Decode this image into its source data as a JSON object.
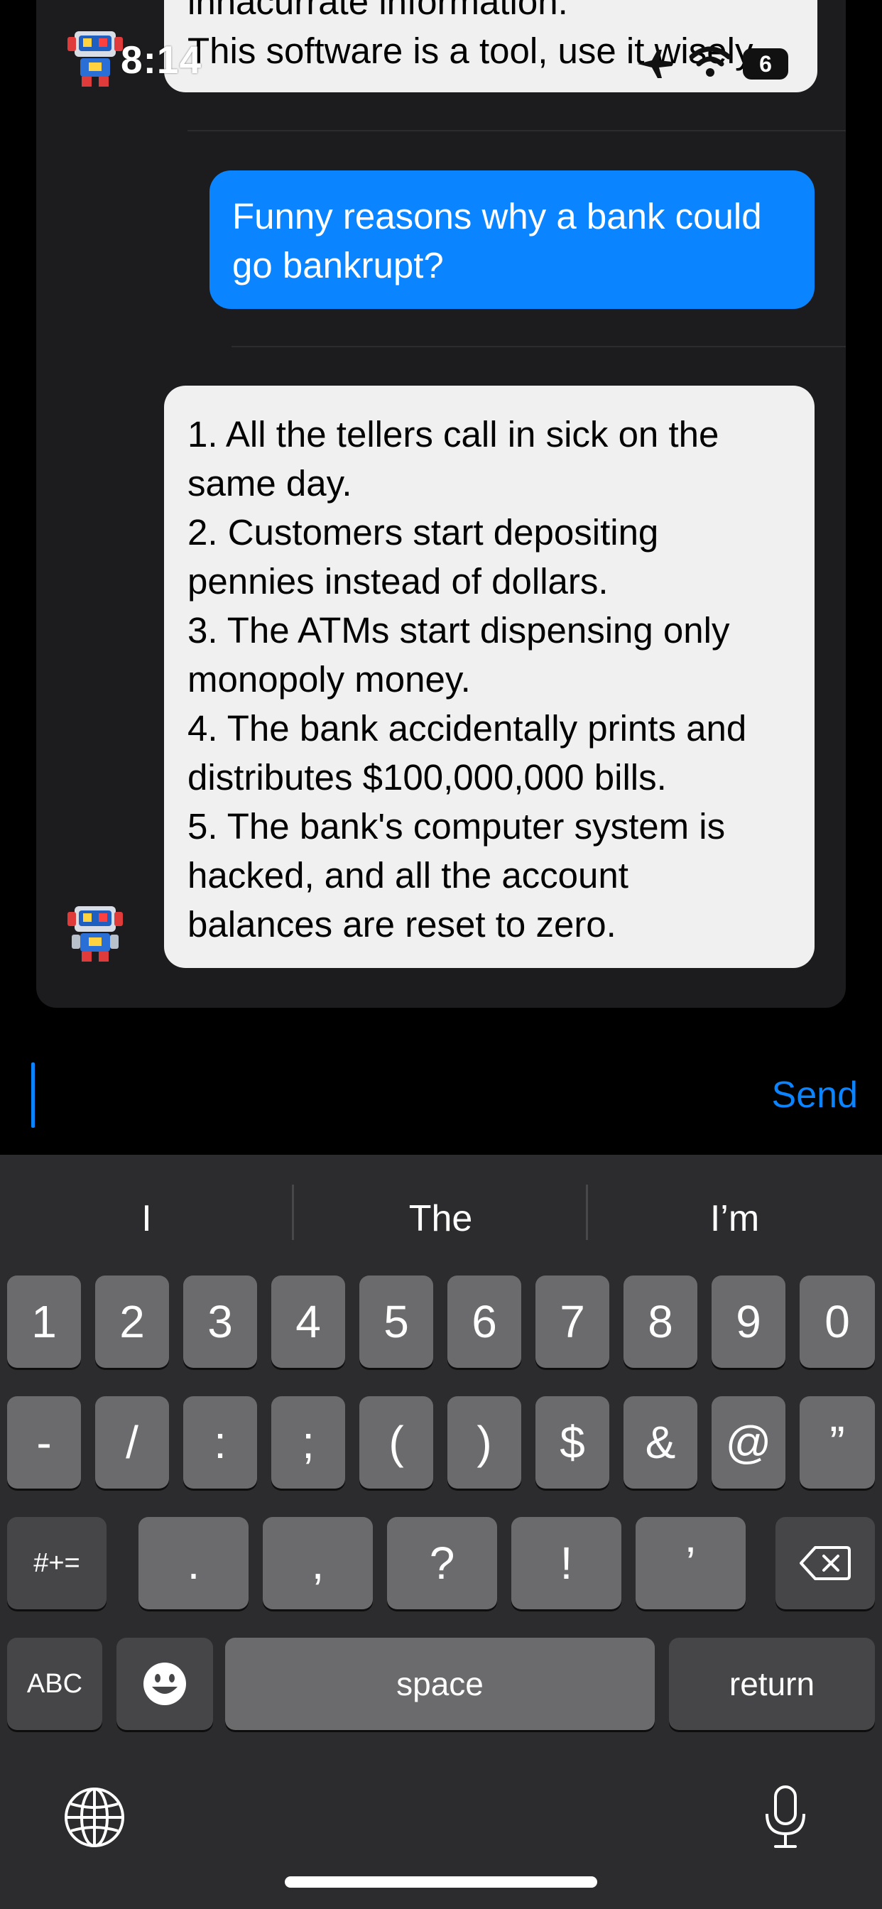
{
  "status_bar": {
    "time": "8:14",
    "battery_level": "6"
  },
  "chat": {
    "top_message_lines": [
      "innacurrate information.",
      "This software is a tool, use it wisely"
    ],
    "user_message": "Funny reasons why a bank could go bankrupt?",
    "reply_lines": [
      " 1. All the tellers call in sick on the",
      "same day.",
      "2. Customers start depositing",
      "pennies instead of dollars.",
      "3. The ATMs start dispensing only",
      "monopoly money.",
      "4. The bank accidentally prints and",
      "distributes $100,000,000 bills.",
      "5. The bank's computer system is",
      "hacked, and all the account",
      "balances are reset to zero."
    ]
  },
  "input": {
    "value": "",
    "send_label": "Send"
  },
  "keyboard": {
    "suggestions": [
      "I",
      "The",
      "I’m"
    ],
    "row1": [
      "1",
      "2",
      "3",
      "4",
      "5",
      "6",
      "7",
      "8",
      "9",
      "0"
    ],
    "row2": [
      "-",
      "/",
      ":",
      ";",
      "(",
      ")",
      "$",
      "&",
      "@",
      "”"
    ],
    "row3": [
      ".",
      ",",
      "?",
      "!",
      "’"
    ],
    "symbols_toggle": "#+=",
    "abc_toggle": "ABC",
    "space_label": "space",
    "return_label": "return",
    "icons": [
      "backspace-icon",
      "emoji-icon",
      "globe-icon",
      "microphone-icon"
    ]
  },
  "colors": {
    "accent": "#0a84ff",
    "bot_bubble": "#f0f0f0",
    "panel": "#1c1c1e",
    "keyboard": "#2c2c2e"
  }
}
